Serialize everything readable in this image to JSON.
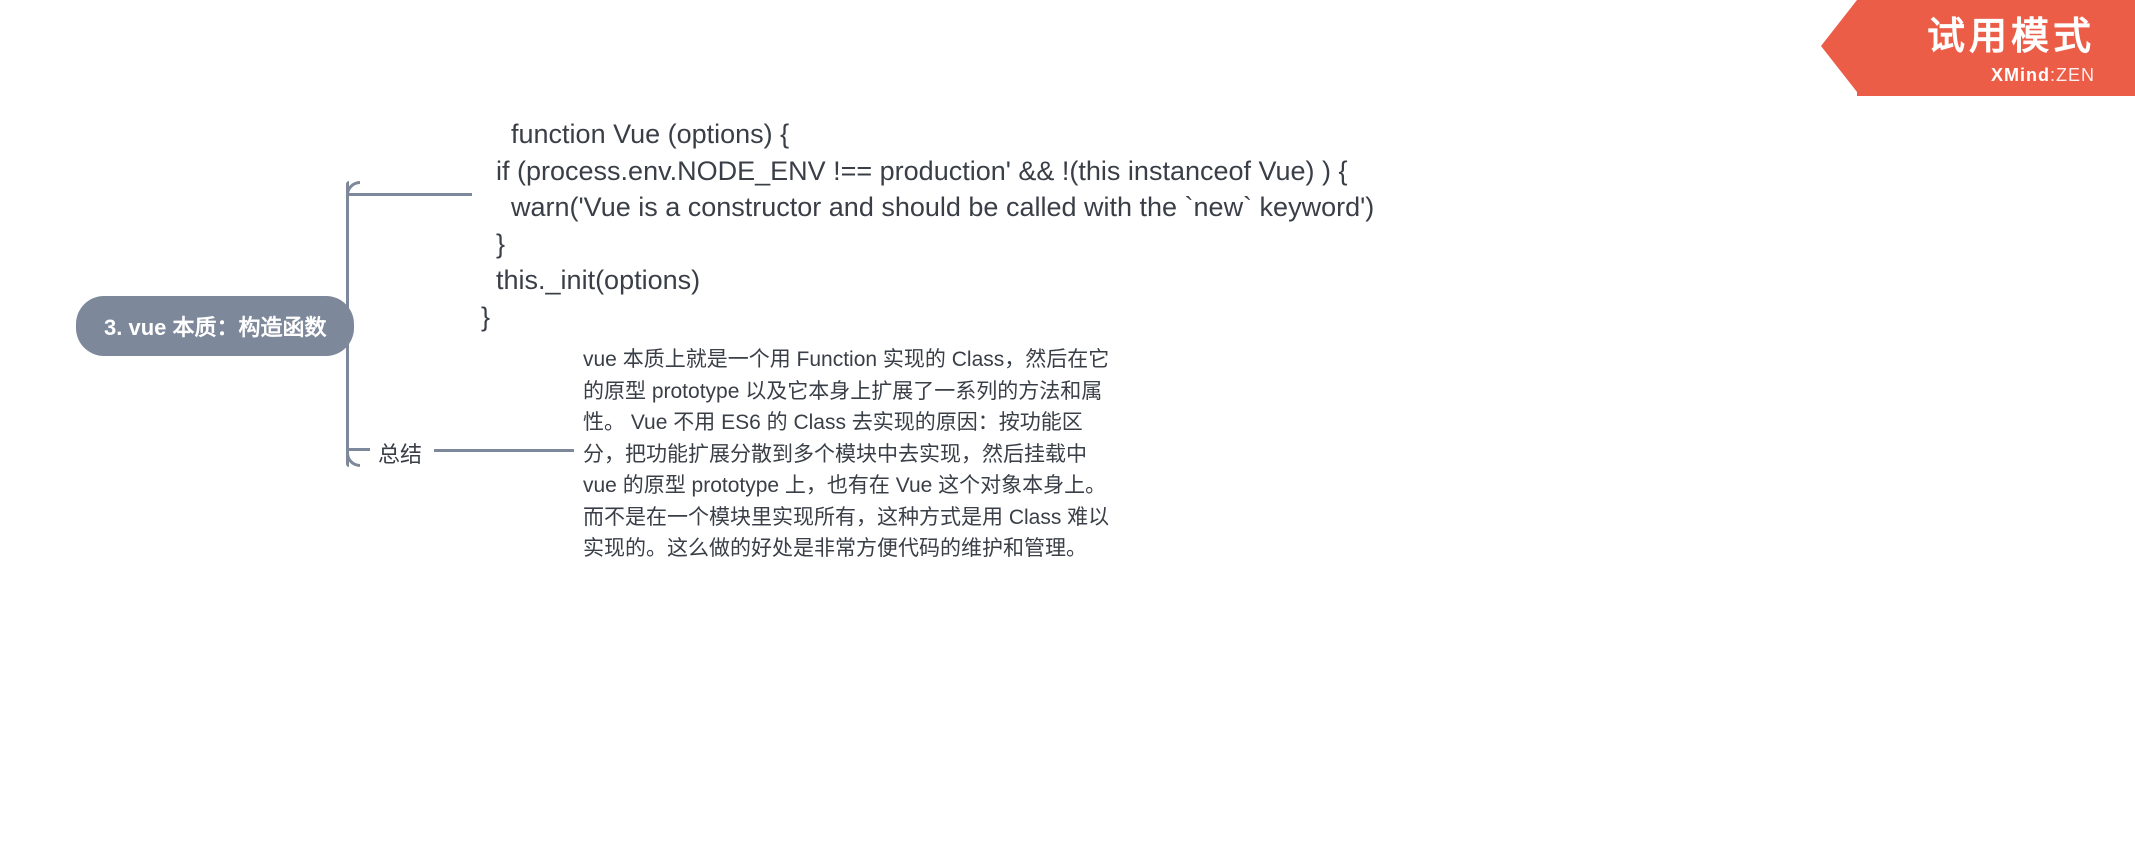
{
  "watermark": {
    "title": "试用模式",
    "brand": "XMind",
    "brand_suffix": ":ZEN"
  },
  "root": {
    "label": "3. vue 本质：构造函数"
  },
  "code": {
    "text": "function Vue (options) {\n  if (process.env.NODE_ENV !== production' && !(this instanceof Vue) ) {\n    warn('Vue is a constructor and should be called with the `new` keyword')\n  }\n  this._init(options)\n}"
  },
  "summary": {
    "label": "总结",
    "body": "vue 本质上就是一个用 Function 实现的 Class，然后在它的原型 prototype 以及它本身上扩展了一系列的方法和属性。\nVue 不用 ES6 的 Class 去实现的原因：按功能区分，把功能扩展分散到多个模块中去实现，然后挂载中 vue 的原型 prototype 上，也有在 Vue 这个对象本身上。\n而不是在一个模块里实现所有，这种方式是用 Class 难以实现的。这么做的好处是非常方便代码的维护和管理。"
  }
}
